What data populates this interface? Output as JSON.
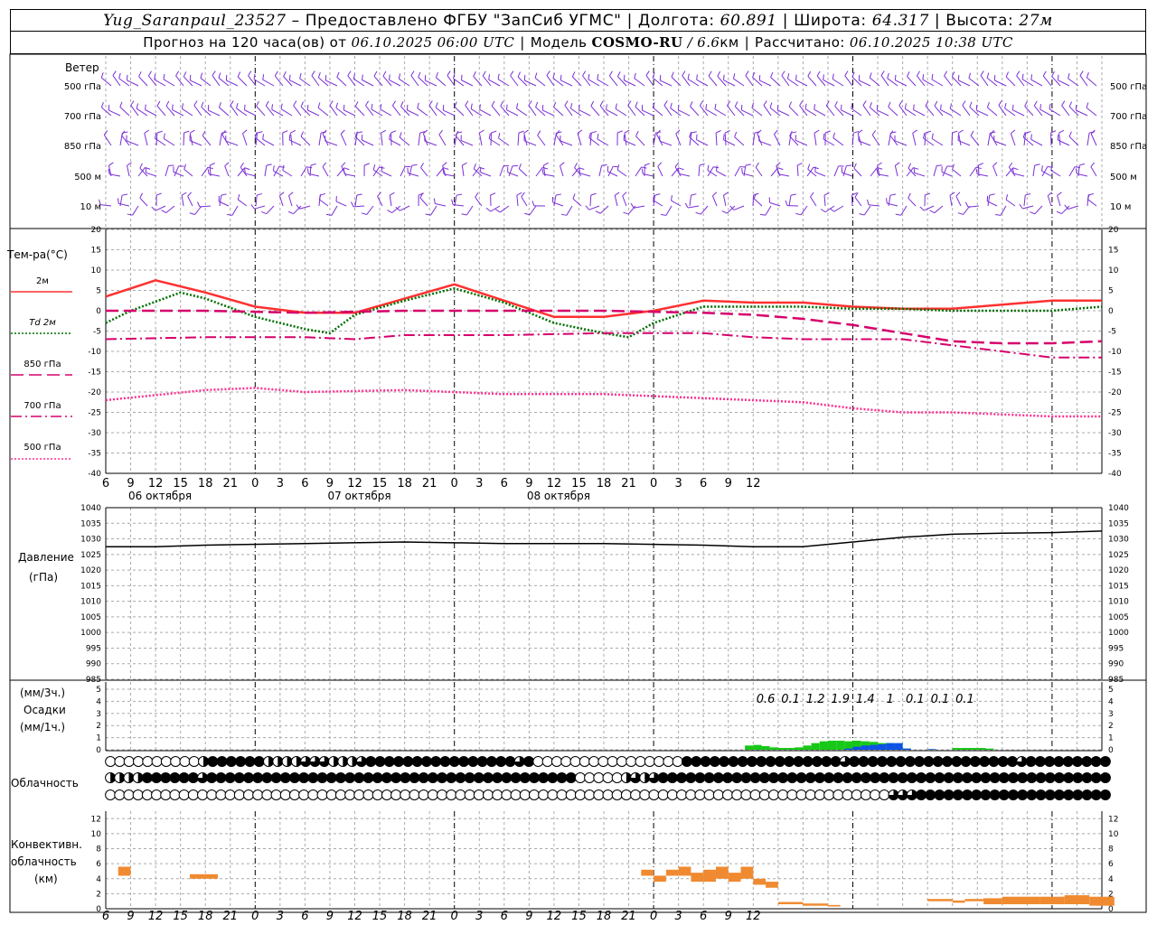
{
  "header": {
    "station": "Yug_Saranpaul_23527",
    "provider": "Предоставлено ФГБУ \"ЗапСиб УГМС\"",
    "lon_label": "Долгота:",
    "lon_value": "60.891",
    "lat_label": "Широта:",
    "lat_value": "64.317",
    "alt_label": "Высота:",
    "alt_value": "27м",
    "forecast_prefix": "Прогноз на 120 часа(ов) от",
    "forecast_time": "06.10.2025 06:00 UTC",
    "model_label": "Модель",
    "model_name": "COSMO-RU",
    "model_res": "/ 6.6",
    "model_res_unit": "км",
    "calc_label": "Рассчитано:",
    "calc_time": "06.10.2025 10:38 UTC"
  },
  "labels": {
    "wind": "Ветер",
    "temp": "Тем-ра(°C)",
    "pressure": "Давление",
    "pressure_unit": "(гПа)",
    "precip_3h": "(мм/3ч.)",
    "precip": "Осадки",
    "precip_1h": "(мм/1ч.)",
    "cloud": "Облачность",
    "conv1": "Конвективн.",
    "conv2": "облачность",
    "conv3": "(км)"
  },
  "colors": {
    "wind": "#7b2fd6",
    "t2m": "#ff3030",
    "td2m": "#007000",
    "t850": "#d6006b",
    "t700": "#d6006b",
    "t500": "#ff3090",
    "precip_green": "#18c818",
    "precip_blue": "#1050e8",
    "conv": "#f08a30"
  },
  "chart_data": [
    {
      "type": "wind_barbs",
      "levels": [
        "500 гПа",
        "700 гПа",
        "850 гПа",
        "500 м",
        "10 м"
      ]
    },
    {
      "type": "line",
      "ylim": [
        -40,
        20
      ],
      "yticks": [
        -40,
        -35,
        -30,
        -25,
        -20,
        -15,
        -10,
        -5,
        0,
        5,
        10,
        15,
        20
      ],
      "hours": [
        6,
        9,
        12,
        15,
        18,
        21,
        0,
        3,
        6,
        9,
        12,
        15,
        18,
        21,
        0,
        3,
        6,
        9,
        12,
        15,
        18,
        21,
        0,
        3,
        6,
        9,
        12
      ],
      "dates": [
        "06 октября",
        "07 октября",
        "08 октября"
      ],
      "series": [
        {
          "name": "2м",
          "style": "solid",
          "x": [
            0,
            6,
            12,
            18,
            24,
            30,
            42,
            48,
            54,
            60,
            66,
            72,
            78,
            84,
            90,
            96,
            102,
            108,
            114,
            120
          ],
          "y": [
            3.5,
            7.5,
            4.5,
            1,
            -0.5,
            -0.5,
            6.5,
            2.5,
            -1.5,
            -1.5,
            0,
            2.5,
            2,
            2,
            1,
            0.5,
            0.5,
            1.5,
            2.5,
            2.5
          ]
        },
        {
          "name": "Td 2м",
          "style": "dotted",
          "x": [
            0,
            3,
            9,
            12,
            18,
            24,
            27,
            30,
            36,
            42,
            48,
            54,
            60,
            63,
            66,
            72,
            78,
            84,
            90,
            96,
            102,
            108,
            114,
            120
          ],
          "y": [
            -3,
            0,
            4.5,
            3,
            -1.5,
            -4.5,
            -5.5,
            -1,
            2.5,
            5.5,
            2,
            -3,
            -5.5,
            -6.5,
            -3,
            1,
            1,
            1,
            0.5,
            0.5,
            0,
            0,
            0,
            1
          ]
        },
        {
          "name": "850 гПа",
          "style": "longdash",
          "x": [
            0,
            12,
            24,
            36,
            48,
            60,
            72,
            78,
            84,
            90,
            96,
            102,
            108,
            114,
            120
          ],
          "y": [
            0,
            0,
            -0.5,
            0,
            0,
            0,
            -0.5,
            -1,
            -2,
            -3.5,
            -5.5,
            -7.5,
            -8,
            -8,
            -7.5
          ]
        },
        {
          "name": "700 гПа",
          "style": "dashdot",
          "x": [
            0,
            12,
            24,
            30,
            36,
            48,
            60,
            72,
            78,
            84,
            90,
            96,
            102,
            108,
            114,
            120
          ],
          "y": [
            -7,
            -6.5,
            -6.5,
            -7,
            -6,
            -6,
            -5.5,
            -5.5,
            -6.5,
            -7,
            -7,
            -7,
            -8.5,
            -10,
            -11.5,
            -11.5
          ]
        },
        {
          "name": "500 гПа",
          "style": "dotted",
          "x": [
            0,
            12,
            18,
            24,
            36,
            48,
            54,
            60,
            66,
            72,
            84,
            90,
            96,
            102,
            108,
            114,
            120
          ],
          "y": [
            -22,
            -19.5,
            -19,
            -20,
            -19.5,
            -20.5,
            -20.5,
            -20.5,
            -21,
            -21.5,
            -22.5,
            -24,
            -25,
            -25,
            -25.5,
            -26,
            -26
          ]
        }
      ]
    },
    {
      "type": "line",
      "ylim": [
        985,
        1040
      ],
      "yticks": [
        985,
        990,
        995,
        1000,
        1005,
        1010,
        1015,
        1020,
        1025,
        1030,
        1035,
        1040
      ],
      "series": [
        {
          "name": "",
          "x": [
            0,
            6,
            12,
            24,
            36,
            48,
            60,
            72,
            78,
            84,
            90,
            96,
            102,
            108,
            114,
            120
          ],
          "y": [
            1027.5,
            1027.5,
            1028,
            1028.5,
            1029,
            1028.5,
            1028.5,
            1028,
            1027.5,
            1027.5,
            1029,
            1030.5,
            1031.5,
            1031.8,
            1032,
            1032.5
          ]
        }
      ]
    },
    {
      "type": "bar",
      "ylim": [
        0,
        5
      ],
      "yticks": [
        0,
        1,
        2,
        3,
        4,
        5
      ],
      "totals_3h": [
        {
          "x": 79.5,
          "text": "0.6"
        },
        {
          "x": 82.5,
          "text": "0.1"
        },
        {
          "x": 85.5,
          "text": "1.2"
        },
        {
          "x": 88.5,
          "text": "1.9"
        },
        {
          "x": 91.5,
          "text": "1.4"
        },
        {
          "x": 94.5,
          "text": "1"
        },
        {
          "x": 97.5,
          "text": "0.1"
        },
        {
          "x": 100.5,
          "text": "0.1"
        },
        {
          "x": 103.5,
          "text": "0.1"
        }
      ],
      "hourly_total": [
        0.35,
        0.4,
        0.3,
        0.2,
        0.15,
        0.15,
        0.2,
        0.35,
        0.55,
        0.7,
        0.75,
        0.75,
        0.7,
        0.75,
        0.7,
        0.65,
        0.55,
        0.55,
        0.5,
        0.1,
        0,
        0,
        0.05,
        0,
        0,
        0.15,
        0.15,
        0.15,
        0.15,
        0.1
      ],
      "hourly_blue": [
        0,
        0,
        0,
        0,
        0,
        0,
        0,
        0,
        0,
        0,
        0,
        0,
        0.1,
        0.25,
        0.35,
        0.4,
        0.45,
        0.55,
        0.55,
        0.1,
        0,
        0,
        0.05,
        0,
        0,
        0,
        0,
        0,
        0,
        0
      ],
      "start_hour": 77
    },
    {
      "type": "heatmap",
      "rows": [
        "OOOOOOOOOOHFFFFFFHHHHQQQHHHQFFFFFFFFFFFFFFFFQFOOOOOOOOOOOOOOOOFFFFFFFFFFFFFFFFFQFFFFFFFFFFFFFFFFFFQFFFFFFFFF",
        "HHHHFFFFFFQFFFFFFFFFFFFFFFFFFFFFFFFFFFFFFFFFFFFFFFFOOOOOHQHQFFFFFFFFFFFFFFFFFFFFFFFFFFFFFFFFFFFFFFFFFFFFFFFFF",
        "OOOOOOOOOOOOOOOOOOOOOOOOOOOOOOOOOOOOOOOOOOOOOOOOOOOOOOOOOOOOOOOOOOOOOOOOOOOOOOOOOOOOOQQQFFFFFFFFFFFFFFFFFFFFF"
      ]
    },
    {
      "type": "bar",
      "ylim": [
        0,
        13
      ],
      "yticks": [
        0,
        2,
        4,
        6,
        8,
        10,
        12
      ],
      "bars": [
        {
          "x0": 2,
          "x1": 4,
          "bottom": 4.4,
          "top": 5.6
        },
        {
          "x0": 13.5,
          "x1": 18,
          "bottom": 4,
          "top": 4.6
        },
        {
          "x0": 86,
          "x1": 88,
          "bottom": 4.4,
          "top": 5.2
        },
        {
          "x0": 88,
          "x1": 90,
          "bottom": 3.6,
          "top": 4.4
        },
        {
          "x0": 90,
          "x1": 92,
          "bottom": 4.4,
          "top": 5.2
        },
        {
          "x0": 92,
          "x1": 94,
          "bottom": 4.4,
          "top": 5.6
        },
        {
          "x0": 94,
          "x1": 96,
          "bottom": 3.6,
          "top": 4.8
        },
        {
          "x0": 96,
          "x1": 98,
          "bottom": 3.6,
          "top": 5.2
        },
        {
          "x0": 98,
          "x1": 100,
          "bottom": 4,
          "top": 5.6
        },
        {
          "x0": 100,
          "x1": 102,
          "bottom": 3.6,
          "top": 4.8
        },
        {
          "x0": 102,
          "x1": 104,
          "bottom": 4,
          "top": 5.6
        },
        {
          "x0": 104,
          "x1": 106,
          "bottom": 3.2,
          "top": 4
        },
        {
          "x0": 106,
          "x1": 108,
          "bottom": 2.8,
          "top": 3.6
        },
        {
          "x0": 108,
          "x1": 112,
          "bottom": 0.6,
          "top": 0.9
        },
        {
          "x0": 112,
          "x1": 116,
          "bottom": 0.4,
          "top": 0.7
        },
        {
          "x0": 116,
          "x1": 118,
          "bottom": 0.3,
          "top": 0.5
        },
        {
          "x0": 132,
          "x1": 136,
          "bottom": 1,
          "top": 1.3
        },
        {
          "x0": 136,
          "x1": 138,
          "bottom": 0.8,
          "top": 1.1
        },
        {
          "x0": 138,
          "x1": 141,
          "bottom": 1,
          "top": 1.3
        },
        {
          "x0": 141,
          "x1": 144,
          "bottom": 0.6,
          "top": 1.4
        },
        {
          "x0": 144,
          "x1": 150,
          "bottom": 0.6,
          "top": 1.6
        },
        {
          "x0": 150,
          "x1": 154,
          "bottom": 0.6,
          "top": 1.6
        },
        {
          "x0": 154,
          "x1": 158,
          "bottom": 0.6,
          "top": 1.8
        },
        {
          "x0": 158,
          "x1": 162,
          "bottom": 0.4,
          "top": 1.6
        }
      ]
    }
  ]
}
